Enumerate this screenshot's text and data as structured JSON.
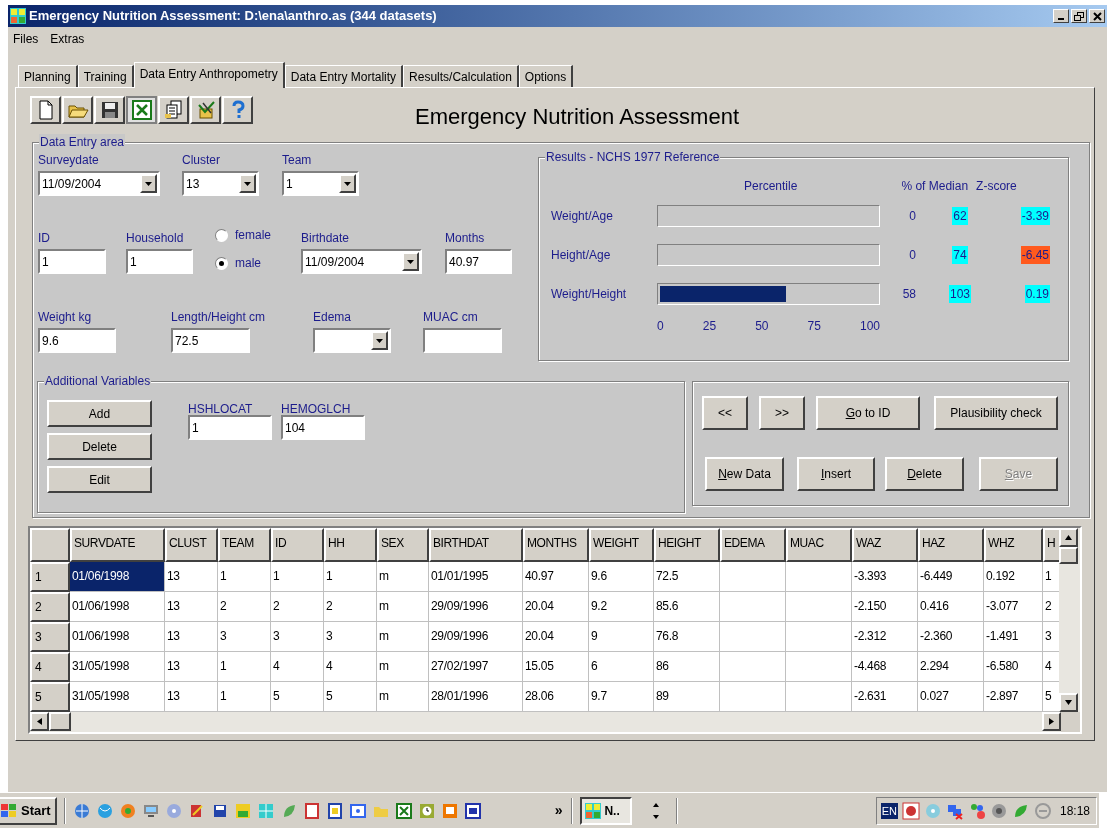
{
  "window": {
    "title": "Emergency Nutrition Assessment: D:\\ena\\anthro.as (344 datasets)"
  },
  "menu": [
    "Files",
    "Extras"
  ],
  "tabs": [
    {
      "label": "Planning",
      "selected": false
    },
    {
      "label": "Training",
      "selected": false
    },
    {
      "label": "Data Entry Anthropometry",
      "selected": true
    },
    {
      "label": "Data Entry Mortality",
      "selected": false
    },
    {
      "label": "Results/Calculation",
      "selected": false
    },
    {
      "label": "Options",
      "selected": false
    }
  ],
  "heading": "Emergency Nutrition Assessment",
  "data_entry": {
    "legend": "Data Entry area",
    "lines": [
      {
        "fields": [
          {
            "kind": "dropdown",
            "label": "Surveydate",
            "value": "11/09/2004"
          },
          {
            "kind": "dropdown",
            "label": "Cluster",
            "value": "13"
          },
          {
            "kind": "dropdown",
            "label": "Team",
            "value": "1"
          }
        ]
      },
      {
        "fields": [
          {
            "kind": "text",
            "label": "ID",
            "value": "1"
          },
          {
            "kind": "text",
            "label": "Household",
            "value": "1"
          },
          {
            "kind": "radio",
            "options": [
              {
                "label": "female",
                "selected": false
              },
              {
                "label": "male",
                "selected": true
              }
            ]
          },
          {
            "kind": "dropdown",
            "label": "Birthdate",
            "value": "11/09/2004"
          },
          {
            "kind": "text",
            "label": "Months",
            "value": "40.97"
          }
        ]
      },
      {
        "fields": [
          {
            "kind": "text",
            "label": "Weight kg",
            "value": "9.6"
          },
          {
            "kind": "text",
            "label": "Length/Height cm",
            "value": "72.5"
          },
          {
            "kind": "dropdown",
            "label": "Edema"
          },
          {
            "kind": "text",
            "label": "MUAC cm"
          }
        ]
      }
    ],
    "additional": {
      "legend": "Additional Variables",
      "buttons": [
        "Add",
        "Delete",
        "Edit"
      ],
      "fields": [
        {
          "label": "HSHLOCAT",
          "value": "1"
        },
        {
          "label": "HEMOGLCH",
          "value": "104"
        }
      ]
    }
  },
  "results": {
    "legend": "Results - NCHS 1977 Reference",
    "percentile_header": "Percentile",
    "median_header": "% of Median",
    "zscore_header": "Z-score",
    "rows": [
      {
        "label": "Weight/Age",
        "level": 0,
        "percentile": "0",
        "median": {
          "text": "62",
          "color": "#00ffff"
        },
        "zscore": {
          "text": "-3.39",
          "color": "#00ffff"
        }
      },
      {
        "label": "Height/Age",
        "level": 0,
        "percentile": "0",
        "median": {
          "text": "74",
          "color": "#00ffff"
        },
        "zscore": {
          "text": "-6.45",
          "color": "#ff5a1e"
        }
      },
      {
        "label": "Weight/Height",
        "level": 0.58,
        "percentile": "58",
        "median": {
          "text": "103",
          "color": "#00ffff"
        },
        "zscore": {
          "text": "0.19",
          "color": "#00ffff"
        }
      }
    ],
    "scale": [
      "0",
      "25",
      "50",
      "75",
      "100"
    ]
  },
  "navigation": [
    {
      "buttons": [
        {
          "label": "<<",
          "mnemonic": false,
          "disabled": false
        },
        {
          "label": ">>",
          "mnemonic": false,
          "disabled": false
        },
        {
          "label": "Go to ID",
          "mnemonic": true,
          "disabled": false
        },
        {
          "label": "Plausibility check",
          "mnemonic": false,
          "disabled": false
        }
      ]
    },
    {
      "buttons": [
        {
          "label": "New Data",
          "mnemonic": true,
          "disabled": false
        },
        {
          "label": "Insert",
          "mnemonic": true,
          "disabled": false
        },
        {
          "label": "Delete",
          "mnemonic": true,
          "disabled": false
        },
        {
          "label": "Save",
          "mnemonic": true,
          "disabled": true
        }
      ]
    }
  ],
  "table": {
    "columns": [
      "SURVDATE",
      "CLUST",
      "TEAM",
      "ID",
      "HH",
      "SEX",
      "BIRTHDAT",
      "MONTHS",
      "WEIGHT",
      "HEIGHT",
      "EDEMA",
      "MUAC",
      "WAZ",
      "HAZ",
      "WHZ",
      "H"
    ],
    "rows": [
      {
        "number": "1",
        "selected": true,
        "cells": [
          "01/06/1998",
          "13",
          "1",
          "1",
          "1",
          "m",
          "01/01/1995",
          "40.97",
          "9.6",
          "72.5",
          null,
          null,
          "-3.393",
          "-6.449",
          "0.192",
          "1"
        ]
      },
      {
        "number": "2",
        "selected": false,
        "cells": [
          "01/06/1998",
          "13",
          "2",
          "2",
          "2",
          "m",
          "29/09/1996",
          "20.04",
          "9.2",
          "85.6",
          null,
          null,
          "-2.150",
          "0.416",
          "-3.077",
          "2"
        ]
      },
      {
        "number": "3",
        "selected": false,
        "cells": [
          "01/06/1998",
          "13",
          "3",
          "3",
          "3",
          "m",
          "29/09/1996",
          "20.04",
          "9",
          "76.8",
          null,
          null,
          "-2.312",
          "-2.360",
          "-1.491",
          "3"
        ]
      },
      {
        "number": "4",
        "selected": false,
        "cells": [
          "31/05/1998",
          "13",
          "1",
          "4",
          "4",
          "m",
          "27/02/1997",
          "15.05",
          "6",
          "86",
          null,
          null,
          "-4.468",
          "2.294",
          "-6.580",
          "4"
        ]
      },
      {
        "number": "5",
        "selected": false,
        "cells": [
          "31/05/1998",
          "13",
          "1",
          "5",
          "5",
          "m",
          "28/01/1996",
          "28.06",
          "9.7",
          "89",
          null,
          null,
          "-2.631",
          "0.027",
          "-2.897",
          "5"
        ]
      }
    ]
  },
  "taskbar": {
    "start": "Start",
    "overflow": "»",
    "task": "N..",
    "language": "EN",
    "clock": "18:18"
  }
}
